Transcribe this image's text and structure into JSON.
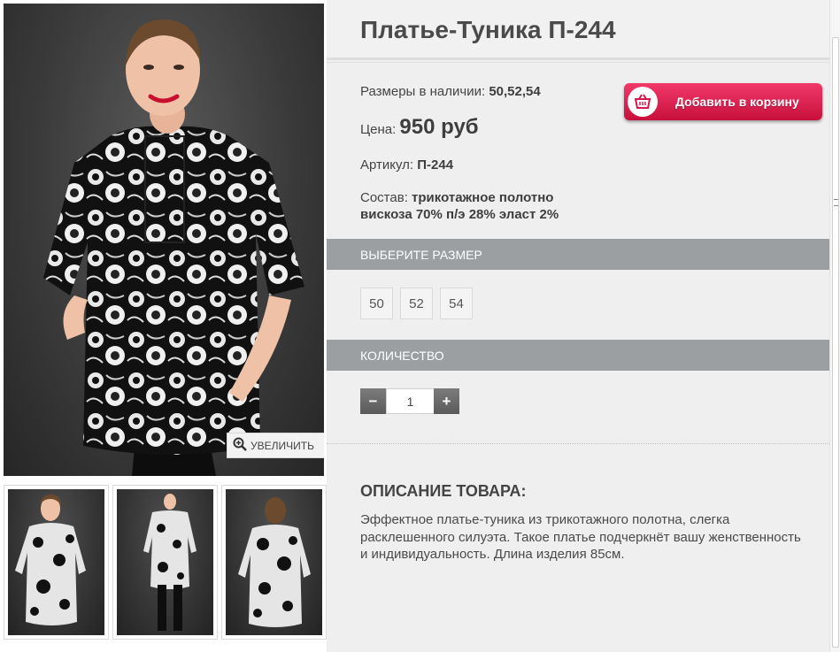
{
  "product": {
    "title": "Платье-Туника П-244",
    "sizes_label": "Размеры в наличии:",
    "sizes_value": "50,52,54",
    "price_label": "Цена:",
    "price_value": "950 руб",
    "article_label": "Артикул:",
    "article_value": "П-244",
    "composition_label": "Состав:",
    "composition_line1": "трикотажное полотно",
    "composition_line2": "вискоза 70% п/э 28% эласт 2%"
  },
  "cart": {
    "button_label": "Добавить в корзину",
    "icon": "basket-icon",
    "color": "#e0245a"
  },
  "gallery": {
    "zoom_label": "УВЕЛИЧИТЬ",
    "zoom_icon": "magnifier-plus-icon",
    "thumbnail_count": 3
  },
  "size_section": {
    "heading": "ВЫБЕРИТЕ РАЗМЕР",
    "options": [
      "50",
      "52",
      "54"
    ]
  },
  "quantity_section": {
    "heading": "КОЛИЧЕСТВО",
    "minus": "−",
    "plus": "+",
    "value": "1"
  },
  "description": {
    "heading": "ОПИСАНИЕ ТОВАРА:",
    "text": "Эффектное платье-туника из трикотажного полотна, слегка расклешенного силуэта. Такое платье подчеркнёт вашу женственность и индивидуальность. Длина изделия 85см."
  },
  "colors": {
    "section_header": "#9c9fa2",
    "panel": "#efefef",
    "accent": "#e0245a"
  }
}
